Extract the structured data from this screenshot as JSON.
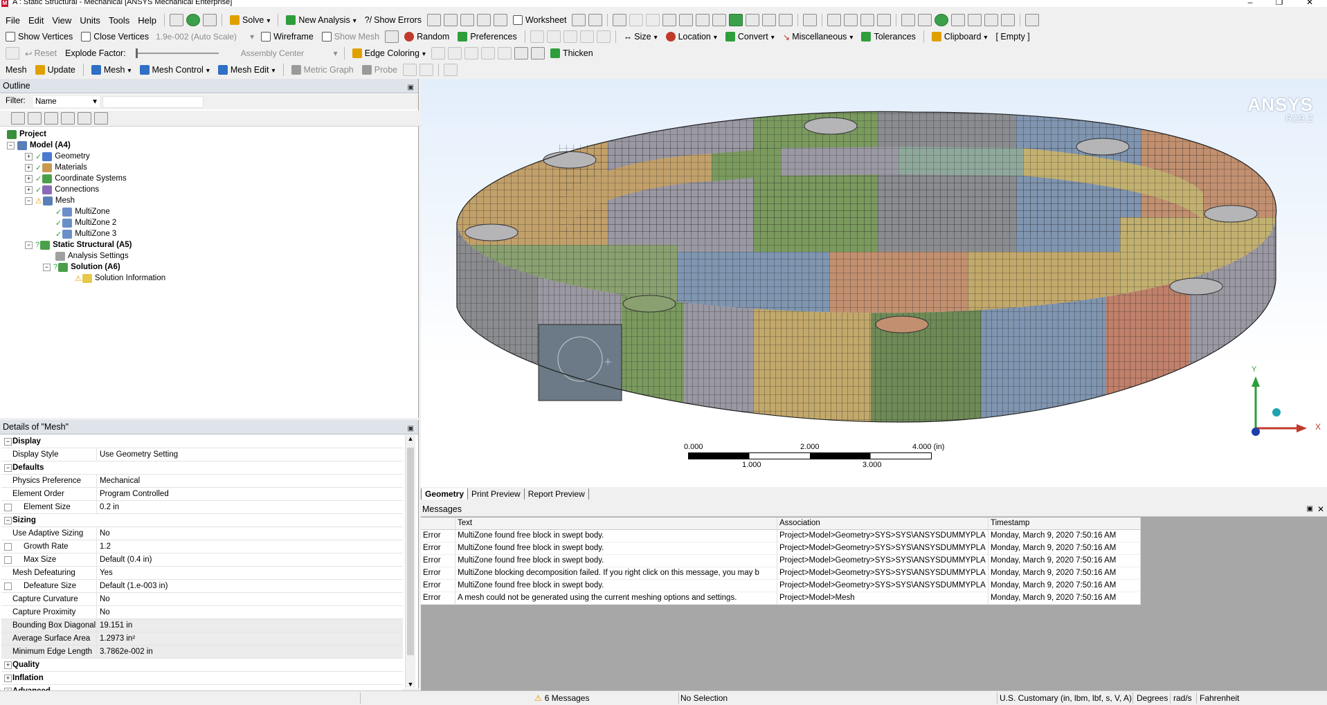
{
  "window": {
    "title": "A : Static Structural - Mechanical [ANSYS Mechanical Enterprise]",
    "app_icon": "M"
  },
  "menu": [
    "File",
    "Edit",
    "View",
    "Units",
    "Tools",
    "Help"
  ],
  "toolbar1": {
    "solve": "Solve",
    "new_analysis": "New Analysis",
    "show_errors": "Show Errors",
    "worksheet": "Worksheet"
  },
  "toolbar2": {
    "show_vertices": "Show Vertices",
    "close_vertices": "Close Vertices",
    "scale": "1.9e-002 (Auto Scale)",
    "wireframe": "Wireframe",
    "show_mesh": "Show Mesh",
    "random": "Random",
    "preferences": "Preferences",
    "size": "Size",
    "location": "Location",
    "convert": "Convert",
    "miscellaneous": "Miscellaneous",
    "tolerances": "Tolerances",
    "clipboard": "Clipboard",
    "clipboard_state": "[ Empty ]"
  },
  "toolbar3": {
    "reset": "Reset",
    "explode_factor": "Explode Factor:",
    "assembly_center": "Assembly Center",
    "edge_coloring": "Edge Coloring",
    "thicken": "Thicken"
  },
  "toolbar4": {
    "mesh": "Mesh",
    "update": "Update",
    "mesh_menu": "Mesh",
    "mesh_control": "Mesh Control",
    "mesh_edit": "Mesh Edit",
    "metric_graph": "Metric Graph",
    "probe": "Probe"
  },
  "outline": {
    "title": "Outline",
    "filter_label": "Filter:",
    "filter_value": "Name",
    "tree": [
      {
        "label": "Project",
        "bold": true
      },
      {
        "label": "Model (A4)",
        "bold": true
      },
      {
        "label": "Geometry"
      },
      {
        "label": "Materials"
      },
      {
        "label": "Coordinate Systems"
      },
      {
        "label": "Connections"
      },
      {
        "label": "Mesh"
      },
      {
        "label": "MultiZone"
      },
      {
        "label": "MultiZone 2"
      },
      {
        "label": "MultiZone 3"
      },
      {
        "label": "Static Structural (A5)",
        "bold": true
      },
      {
        "label": "Analysis Settings"
      },
      {
        "label": "Solution (A6)",
        "bold": true
      },
      {
        "label": "Solution Information"
      }
    ]
  },
  "details": {
    "title": "Details of \"Mesh\"",
    "rows": [
      {
        "type": "group",
        "k": "Display",
        "sign": "−"
      },
      {
        "k": "Display Style",
        "v": "Use Geometry Setting"
      },
      {
        "type": "group",
        "k": "Defaults",
        "sign": "−"
      },
      {
        "k": "Physics Preference",
        "v": "Mechanical"
      },
      {
        "k": "Element Order",
        "v": "Program Controlled"
      },
      {
        "k": "Element Size",
        "v": "0.2 in",
        "cb": true
      },
      {
        "type": "group",
        "k": "Sizing",
        "sign": "−"
      },
      {
        "k": "Use Adaptive Sizing",
        "v": "No"
      },
      {
        "k": "Growth Rate",
        "v": "1.2",
        "cb": true
      },
      {
        "k": "Max Size",
        "v": "Default (0.4 in)",
        "cb": true
      },
      {
        "k": "Mesh Defeaturing",
        "v": "Yes"
      },
      {
        "k": "Defeature Size",
        "v": "Default (1.e-003 in)",
        "cb": true
      },
      {
        "k": "Capture Curvature",
        "v": "No"
      },
      {
        "k": "Capture Proximity",
        "v": "No"
      },
      {
        "k": "Bounding Box Diagonal",
        "v": "19.151 in",
        "grey": true
      },
      {
        "k": "Average Surface Area",
        "v": "1.2973 in²",
        "grey": true
      },
      {
        "k": "Minimum Edge Length",
        "v": "3.7862e-002 in",
        "grey": true
      },
      {
        "type": "group",
        "k": "Quality",
        "sign": "+"
      },
      {
        "type": "group",
        "k": "Inflation",
        "sign": "+"
      },
      {
        "type": "group",
        "k": "Advanced",
        "sign": "+"
      }
    ]
  },
  "viewport": {
    "brand": "ANSYS",
    "version": "R19.2",
    "scale_top": [
      "0.000",
      "2.000",
      "4.000 (in)"
    ],
    "scale_bottom": [
      "1.000",
      "3.000"
    ],
    "axis_y": "Y",
    "axis_x": "X"
  },
  "viewport_tabs": [
    "Geometry",
    "Print Preview",
    "Report Preview"
  ],
  "messages": {
    "title": "Messages",
    "headers": [
      "",
      "Text",
      "Association",
      "Timestamp"
    ],
    "rows": [
      [
        "Error",
        "MultiZone found free block in swept body.",
        "Project>Model>Geometry>SYS>SYS\\ANSYSDUMMYPLA",
        "Monday, March 9, 2020 7:50:16 AM"
      ],
      [
        "Error",
        "MultiZone found free block in swept body.",
        "Project>Model>Geometry>SYS>SYS\\ANSYSDUMMYPLA",
        "Monday, March 9, 2020 7:50:16 AM"
      ],
      [
        "Error",
        "MultiZone found free block in swept body.",
        "Project>Model>Geometry>SYS>SYS\\ANSYSDUMMYPLA",
        "Monday, March 9, 2020 7:50:16 AM"
      ],
      [
        "Error",
        "MultiZone blocking decomposition failed. If you right click on this message, you may b",
        "Project>Model>Geometry>SYS>SYS\\ANSYSDUMMYPLA",
        "Monday, March 9, 2020 7:50:16 AM"
      ],
      [
        "Error",
        "MultiZone found free block in swept body.",
        "Project>Model>Geometry>SYS>SYS\\ANSYSDUMMYPLA",
        "Monday, March 9, 2020 7:50:16 AM"
      ],
      [
        "Error",
        "A mesh could not be generated using the current meshing options and settings.",
        "Project>Model>Mesh",
        "Monday, March 9, 2020 7:50:16 AM"
      ]
    ]
  },
  "status": {
    "messages": "6 Messages",
    "selection": "No Selection",
    "units": "U.S. Customary (in, lbm, lbf, s, V, A)",
    "angle": "Degrees",
    "rate": "rad/s",
    "temp": "Fahrenheit"
  },
  "colors": {
    "panel_header": "#dfe3ea",
    "error_warning": "#e0a000",
    "mesh_green": "#7a9a5e",
    "mesh_blue": "#7f95b0",
    "mesh_tan": "#c2a06a",
    "mesh_grey": "#9a98a2"
  }
}
